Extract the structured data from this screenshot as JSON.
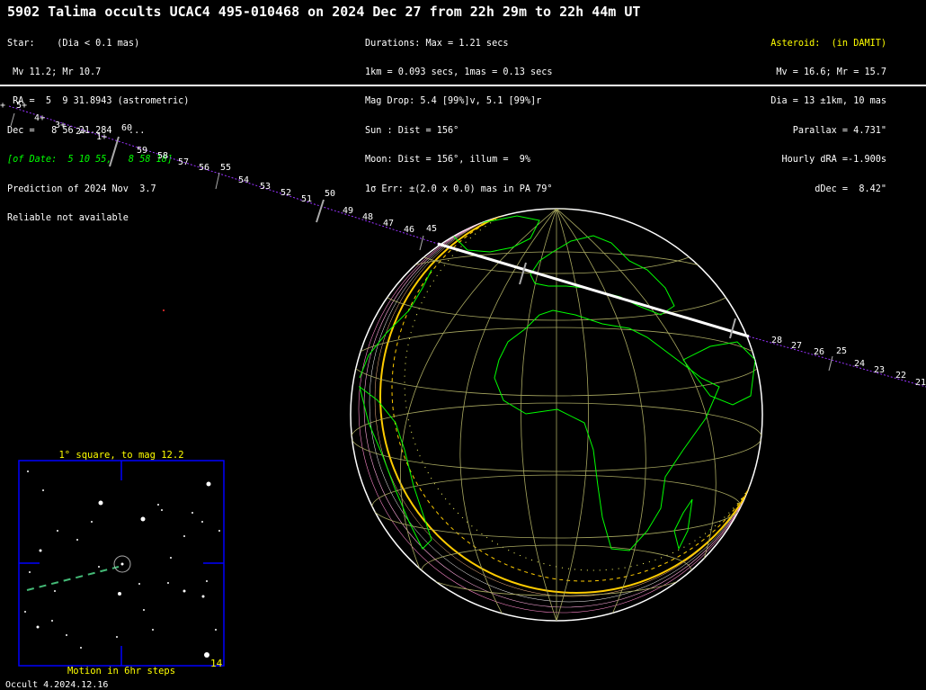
{
  "title": "5902 Talima occults UCAC4 495-010468 on 2024 Dec 27 from 22h 29m to 22h 44m UT",
  "left_block": [
    {
      "text": "Star:    (Dia < 0.1 mas)",
      "style": "white"
    },
    {
      "text": " Mv 11.2; Mr 10.7",
      "style": "white"
    },
    {
      "text": " RA =  5  9 31.8943 (astrometric)",
      "style": "white"
    },
    {
      "text": "Dec =   8 56 21.284   ...",
      "style": "white"
    },
    {
      "text": "[of Date:  5 10 55,   8 58 18]",
      "style": "green"
    },
    {
      "text": "Prediction of 2024 Nov  3.7",
      "style": "white"
    },
    {
      "text": "Reliable not available",
      "style": "white"
    }
  ],
  "middle_block": [
    "Durations: Max = 1.21 secs",
    "1km = 0.093 secs, 1mas = 0.13 secs",
    "Mag Drop: 5.4 [99%]v, 5.1 [99%]r",
    "Sun : Dist = 156°",
    "Moon: Dist = 156°, illum =  9%",
    "1σ Err: ±(2.0 x 0.0) mas in PA 79°"
  ],
  "right_block": {
    "heading": "Asteroid:  (in DAMIT)",
    "lines": [
      "Mv = 16.6; Mr = 15.7",
      "Dia = 13 ±1km, 10 mas",
      "Parallax = 4.731\"",
      "Hourly dRA =-1.900s",
      "dDec =  8.42\""
    ]
  },
  "path_minute_labels": [
    "+",
    "5+",
    "4+",
    "3+",
    "2+",
    "1+",
    "60",
    "59",
    "58",
    "57",
    "56",
    "55",
    "54",
    "53",
    "52",
    "51",
    "50",
    "49",
    "48",
    "47",
    "46",
    "45",
    "28",
    "27",
    "26",
    "25",
    "24",
    "23",
    "22",
    "21"
  ],
  "star_chart": {
    "title": "1° square, to mag 12.2",
    "footer": "Motion in 6hr steps",
    "corner_number": "14"
  },
  "version": "Occult 4.2024.12.16",
  "colors": {
    "background": "#000000",
    "coastline": "#00ff00",
    "grid": "#a8a860",
    "path": "#9933ff",
    "chart_border": "#0000ff",
    "highlight": "#ffff00"
  }
}
